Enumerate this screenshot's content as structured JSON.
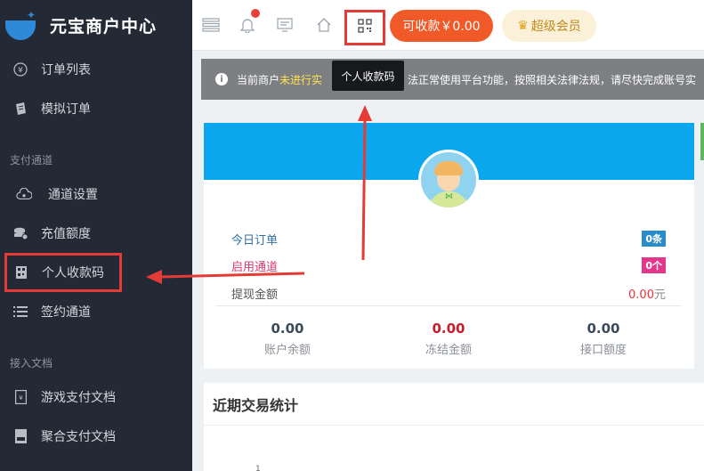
{
  "brand": {
    "title": "元宝商户中心"
  },
  "sidebar": {
    "items": [
      {
        "label": "订单列表",
        "icon": "yen-circle-icon"
      },
      {
        "label": "模拟订单",
        "icon": "document-icon"
      }
    ],
    "section_payment": "支付通道",
    "payment_items": [
      {
        "label": "通道设置",
        "icon": "cloud-settings-icon"
      },
      {
        "label": "充值额度",
        "icon": "coins-icon"
      },
      {
        "label": "个人收款码",
        "icon": "qr-code-icon"
      },
      {
        "label": "签约通道",
        "icon": "list-icon"
      }
    ],
    "section_docs": "接入文档",
    "doc_items": [
      {
        "label": "游戏支付文档",
        "icon": "doc-icon"
      },
      {
        "label": "聚合支付文档",
        "icon": "pdf-icon"
      }
    ]
  },
  "header": {
    "pay_button": "可收款￥0.00",
    "vip_button": "超级会员",
    "tooltip": "个人收款码"
  },
  "notice": {
    "prefix": "当前商户",
    "warn": "未进行实",
    "suffix": "法正常使用平台功能，按照相关法律法规，请尽快完成账号实"
  },
  "profile": {
    "today_orders_label": "今日订单",
    "today_orders_badge": "0条",
    "channels_label": "启用通道",
    "channels_badge": "0个",
    "withdraw_label": "提现金额",
    "withdraw_amount": "0.00",
    "withdraw_unit": "元",
    "stats": [
      {
        "value": "0.00",
        "label": "账户余额"
      },
      {
        "value": "0.00",
        "label": "冻结金额"
      },
      {
        "value": "0.00",
        "label": "接口额度"
      }
    ]
  },
  "recent": {
    "title": "近期交易统计",
    "tick": "1"
  },
  "colors": {
    "sidebar": "#232a35",
    "accent": "#f05a28",
    "banner": "#0aa7ee",
    "highlight": "#e53b36"
  }
}
